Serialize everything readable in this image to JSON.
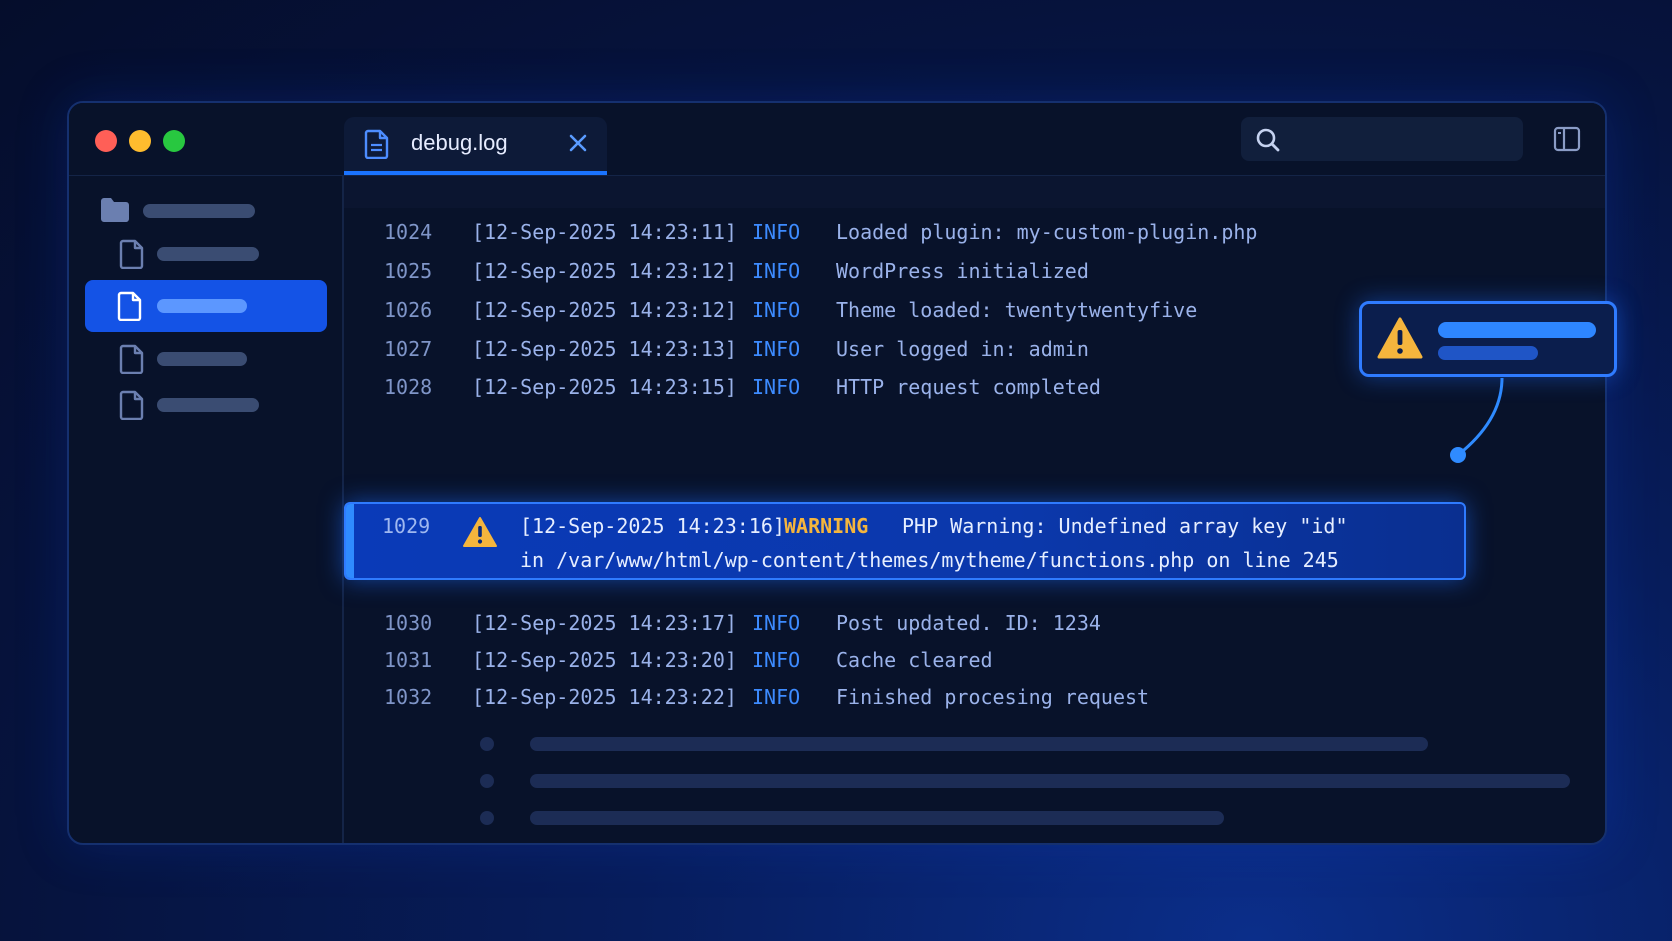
{
  "window": {
    "controls": [
      "close",
      "minimize",
      "maximize"
    ],
    "tab": {
      "label": "debug.log",
      "icon": "document-icon",
      "close_icon": "close-icon"
    },
    "search": {
      "icon": "search-icon",
      "placeholder": ""
    },
    "layout_icon": "sidebar-toggle-icon"
  },
  "sidebar": {
    "items": [
      {
        "icon": "folder-icon",
        "selected": false
      },
      {
        "icon": "file-icon",
        "selected": false
      },
      {
        "icon": "file-icon",
        "selected": true
      },
      {
        "icon": "file-icon",
        "selected": false
      },
      {
        "icon": "file-icon",
        "selected": false
      }
    ]
  },
  "log": {
    "rows_before": [
      {
        "line": "1024",
        "timestamp": "[12-Sep-2025 14:23:11]",
        "level": "INFO",
        "message": "Loaded plugin: my-custom-plugin.php"
      },
      {
        "line": "1025",
        "timestamp": "[12-Sep-2025 14:23:12]",
        "level": "INFO",
        "message": "WordPress initialized"
      },
      {
        "line": "1026",
        "timestamp": "[12-Sep-2025 14:23:12]",
        "level": "INFO",
        "message": "Theme loaded: twentytwentyfive"
      },
      {
        "line": "1027",
        "timestamp": "[12-Sep-2025 14:23:13]",
        "level": "INFO",
        "message": "User logged in: admin"
      },
      {
        "line": "1028",
        "timestamp": "[12-Sep-2025 14:23:15]",
        "level": "INFO",
        "message": "HTTP request completed"
      }
    ],
    "warning": {
      "line": "1029",
      "timestamp": "[12-Sep-2025 14:23:16]",
      "level": "WARNING",
      "message": "PHP Warning: Undefined array key \"id\"",
      "detail": "in /var/www/html/wp-content/themes/mytheme/functions.php on line 245",
      "icon": "warning-icon"
    },
    "rows_after": [
      {
        "line": "1030",
        "timestamp": "[12-Sep-2025 14:23:17]",
        "level": "INFO",
        "message": "Post updated. ID: 1234"
      },
      {
        "line": "1031",
        "timestamp": "[12-Sep-2025 14:23:20]",
        "level": "INFO",
        "message": "Cache cleared"
      },
      {
        "line": "1032",
        "timestamp": "[12-Sep-2025 14:23:22]",
        "level": "INFO",
        "message": "Finished procesing request"
      }
    ]
  },
  "notification": {
    "icon": "warning-icon"
  },
  "colors": {
    "accent": "#1a73ff",
    "info": "#3d8bff",
    "warning": "#f5b53d",
    "window_bg": "#08122a"
  }
}
